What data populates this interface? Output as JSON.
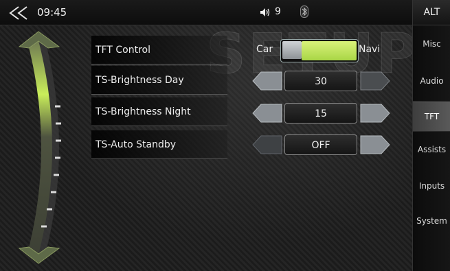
{
  "status": {
    "time": "09:45",
    "volume": "9"
  },
  "tabs": {
    "alt": "ALT",
    "items": [
      {
        "label": "Misc",
        "active": false
      },
      {
        "label": "Audio",
        "active": false
      },
      {
        "label": "TFT",
        "active": true
      },
      {
        "label": "Assists",
        "active": false
      },
      {
        "label": "Inputs",
        "active": false
      },
      {
        "label": "System",
        "active": false
      }
    ]
  },
  "watermark": "SETUP",
  "settings": {
    "tft_control": {
      "label": "TFT Control",
      "left_option": "Car",
      "right_option": "Navi"
    },
    "brightness_day": {
      "label": "TS-Brightness Day",
      "value": "30"
    },
    "brightness_night": {
      "label": "TS-Brightness Night",
      "value": "15"
    },
    "auto_standby": {
      "label": "TS-Auto Standby",
      "value": "OFF"
    }
  },
  "colors": {
    "accent": "#c6e86a",
    "active_tab": "#555555"
  },
  "icons": {
    "back": "back-chevrons-icon",
    "volume": "speaker-icon",
    "bluetooth": "bluetooth-icon"
  }
}
